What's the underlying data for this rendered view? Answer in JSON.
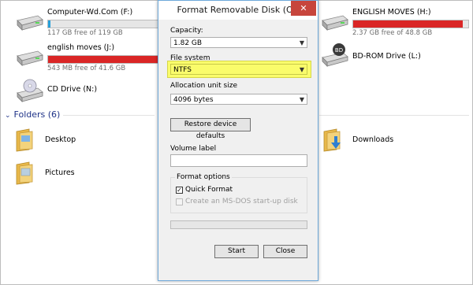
{
  "drives": [
    {
      "name": "Computer-Wd.Com (F:)",
      "free_text": "117 GB free of 119 GB",
      "used_fraction": 0.02,
      "icon": "hard-drive-icon"
    },
    {
      "name": "english moves (J:)",
      "free_text": "543 MB free of 41.6 GB",
      "used_fraction": 0.99,
      "icon": "hard-drive-icon"
    },
    {
      "name": "CD Drive (N:)",
      "icon": "cd-drive-icon"
    },
    {
      "name": "ENGLISH MOVES (H:)",
      "free_text": "2.37 GB free of 48.8 GB",
      "used_fraction": 0.95,
      "icon": "hard-drive-icon"
    },
    {
      "name": "BD-ROM Drive (L:)",
      "icon": "bd-rom-drive-icon"
    }
  ],
  "bd_badge": "BD",
  "folders_section": {
    "title": "Folders (6)"
  },
  "folders": [
    {
      "name": "Desktop",
      "icon": "desktop-folder-icon"
    },
    {
      "name": "Pictures",
      "icon": "pictures-folder-icon"
    },
    {
      "name": "Downloads",
      "icon": "downloads-folder-icon"
    }
  ],
  "dialog": {
    "title": "Format Removable Disk (O:)",
    "close_glyph": "✕",
    "capacity_label": "Capacity:",
    "capacity_value": "1.82 GB",
    "filesystem_label": "File system",
    "filesystem_value": "NTFS",
    "allocation_label": "Allocation unit size",
    "allocation_value": "4096 bytes",
    "restore_button": "Restore device defaults",
    "volume_label": "Volume label",
    "volume_value": "",
    "format_options_label": "Format options",
    "quick_format_label": "Quick Format",
    "quick_format_checked": true,
    "msdos_label": "Create an MS-DOS start-up disk",
    "msdos_checked": false,
    "progress": 0,
    "start_button": "Start",
    "close_button": "Close"
  },
  "colors": {
    "accent_bar": "#26a0da",
    "full_bar": "#da2626",
    "highlight": "#fafc6b",
    "close_button": "#c7453c"
  }
}
